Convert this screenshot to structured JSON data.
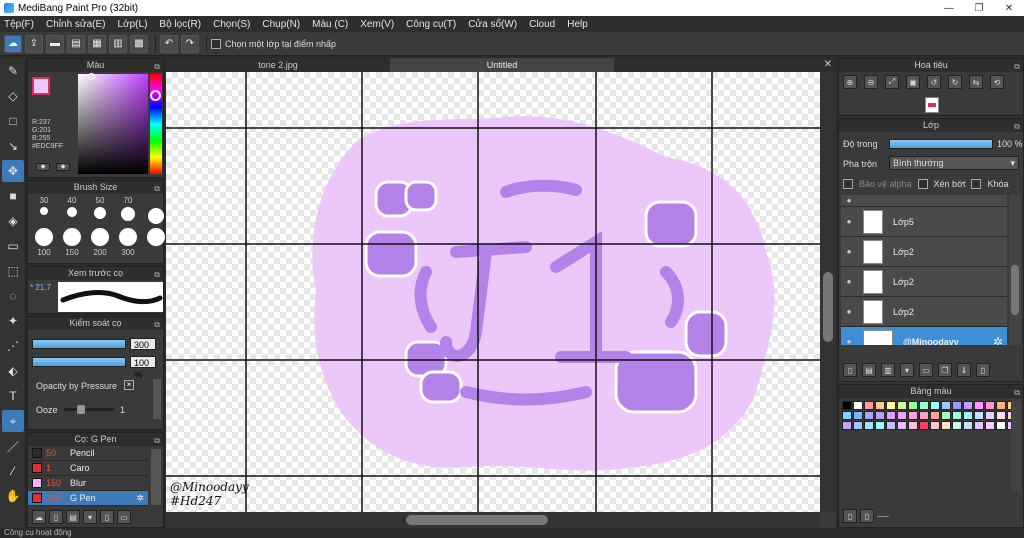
{
  "window": {
    "title": "MediBang Paint Pro (32bit)"
  },
  "menu": [
    "Tệp(F)",
    "Chỉnh sửa(E)",
    "Lớp(L)",
    "Bộ lọc(R)",
    "Chọn(S)",
    "Chụp(N)",
    "Màu (C)",
    "Xem(V)",
    "Công cụ(T)",
    "Cửa sổ(W)",
    "Cloud",
    "Help"
  ],
  "toolbar": {
    "select_layer_label": "Chọn một lớp tại điểm nhấp"
  },
  "tabs": [
    "tone 2.jpg",
    "Untitled"
  ],
  "color_panel": {
    "title": "Màu",
    "r": "R:237",
    "g": "G:201",
    "b": "B:255",
    "hex": "#EDC9FF",
    "fg_color": "#edc9ff",
    "bg_color": "#ffffff"
  },
  "brush_size_panel": {
    "title": "Brush Size",
    "row1": [
      "30",
      "40",
      "50",
      "70"
    ],
    "row2": [
      "100",
      "150",
      "200",
      "300"
    ]
  },
  "preview_panel": {
    "title": "Xem trước cọ",
    "value": "* 21.7"
  },
  "brush_control": {
    "title": "Kiểm soát cọ",
    "size_value": "300",
    "opacity_value": "100 %",
    "opacity_pressure_label": "Opacity by Pressure",
    "opacity_pressure_check": "×",
    "ooze_label": "Ooze",
    "ooze_value": "1",
    "ooze_level": 0.3
  },
  "brush_list": {
    "title": "Cọ: G Pen",
    "items": [
      {
        "size": "50",
        "name": "Pencil",
        "color": "#2b2b2b"
      },
      {
        "size": "1",
        "name": "Caro",
        "color": "#e03030"
      },
      {
        "size": "150",
        "name": "Blur",
        "color": "#f2b4f2"
      },
      {
        "size": "300",
        "name": "G Pen",
        "color": "#e03030"
      }
    ]
  },
  "navigator": {
    "title": "Hoa tiêu"
  },
  "layer_panel": {
    "title": "Lớp",
    "opacity_label": "Độ trong",
    "opacity_value": "100 %",
    "blend_label": "Pha trộn",
    "blend_value": "Bình thường",
    "protect_alpha": "Bảo vệ alpha",
    "clipping": "Xén bớt",
    "lock": "Khóa",
    "layers": [
      {
        "name": "Lớp5"
      },
      {
        "name": "Lớp2"
      },
      {
        "name": "Lớp2"
      },
      {
        "name": "Lớp2"
      },
      {
        "name": "@Minoodayy"
      }
    ]
  },
  "palette_panel": {
    "title": "Bảng màu",
    "colors": [
      "#000000",
      "#ffffff",
      "#ff9999",
      "#ffcc99",
      "#ffff99",
      "#ccff99",
      "#99ff99",
      "#99ffcc",
      "#99ffff",
      "#99ccff",
      "#9999ff",
      "#cc99ff",
      "#ff99ff",
      "#ff99cc",
      "#ffb380",
      "#ffd27f",
      "#7fd1ff",
      "#7fb2ff",
      "#9fa8ff",
      "#b8a0ff",
      "#d6a0ff",
      "#f0a0ff",
      "#ffa0e0",
      "#ffa0c0",
      "#ffa0a0",
      "#a0ffc0",
      "#a0ffe0",
      "#a0f0ff",
      "#c0e0ff",
      "#e0d0ff",
      "#ffe0f0",
      "#ffd0d0",
      "#c8a0ff",
      "#a0c8ff",
      "#a0e0ff",
      "#a0ffff",
      "#c0c0ff",
      "#e0c0ff",
      "#ffc0e0",
      "#ff4060",
      "#ffc8c8",
      "#ffe0c8",
      "#c8ffe0",
      "#c8e0ff",
      "#e0c8ff",
      "#ffc8ff",
      "#ffffff",
      "#edc9ff"
    ],
    "footer": "----"
  },
  "canvas_art": {
    "watermark1": "@Minoodayy",
    "watermark2": "#Hd247"
  },
  "status": "Công cụ hoạt động"
}
